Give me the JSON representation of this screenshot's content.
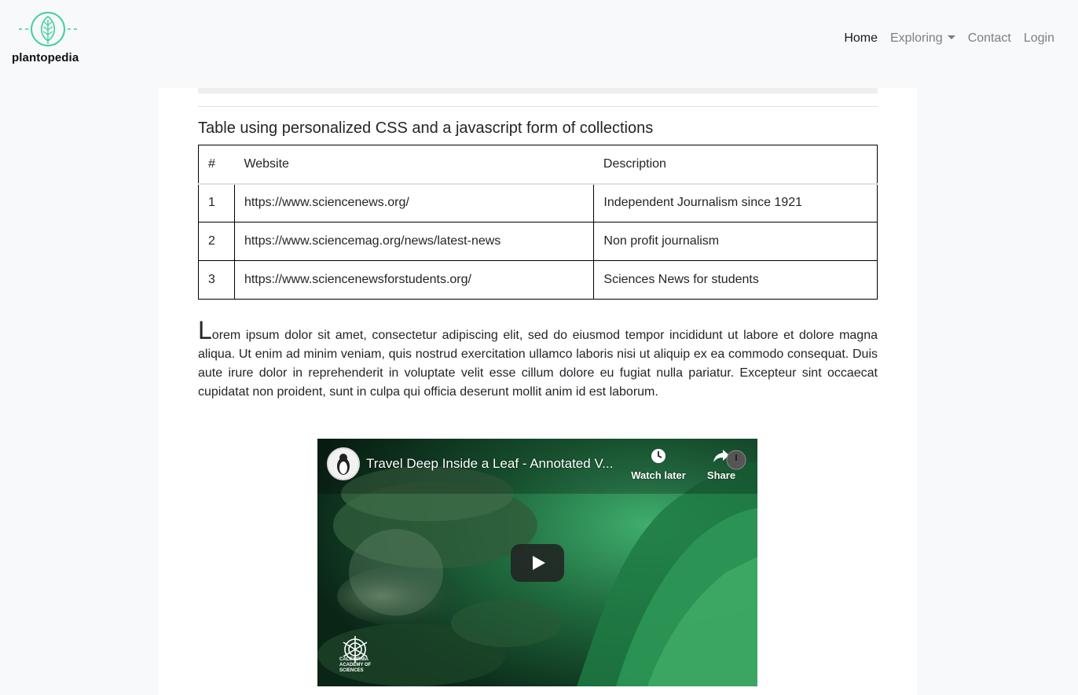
{
  "brand": {
    "name": "plantopedia",
    "logo_icon": "leaf-icon",
    "accent": "#3ecf9a"
  },
  "nav": {
    "items": [
      {
        "label": "Home",
        "active": true
      },
      {
        "label": "Exploring",
        "dropdown": true
      },
      {
        "label": "Contact"
      },
      {
        "label": "Login"
      }
    ]
  },
  "table": {
    "caption": "Table using personalized CSS and a javascript form of collections",
    "headers": [
      "#",
      "Website",
      "Description"
    ],
    "rows": [
      [
        "1",
        "https://www.sciencenews.org/",
        "Independent Journalism since 1921"
      ],
      [
        "2",
        "https://www.sciencemag.org/news/latest-news",
        "Non profit journalism"
      ],
      [
        "3",
        "https://www.sciencenewsforstudents.org/",
        "Sciences News for students"
      ]
    ]
  },
  "lorem": {
    "dropcap": "L",
    "text": "orem ipsum dolor sit amet, consectetur adipiscing elit, sed do eiusmod tempor incididunt ut labore et dolore magna aliqua. Ut enim ad minim veniam, quis nostrud exercitation ullamco laboris nisi ut aliquip ex ea commodo consequat. Duis aute irure dolor in reprehenderit in voluptate velit esse cillum dolore eu fugiat nulla pariatur. Excepteur sint occaecat cupidatat non proident, sunt in culpa qui officia deserunt mollit anim id est laborum."
  },
  "video": {
    "title": "Travel Deep Inside a Leaf - Annotated V...",
    "watch_later_label": "Watch later",
    "share_label": "Share",
    "watermark_text": "CALIFORNIA ACADEMY OF SCIENCES"
  }
}
